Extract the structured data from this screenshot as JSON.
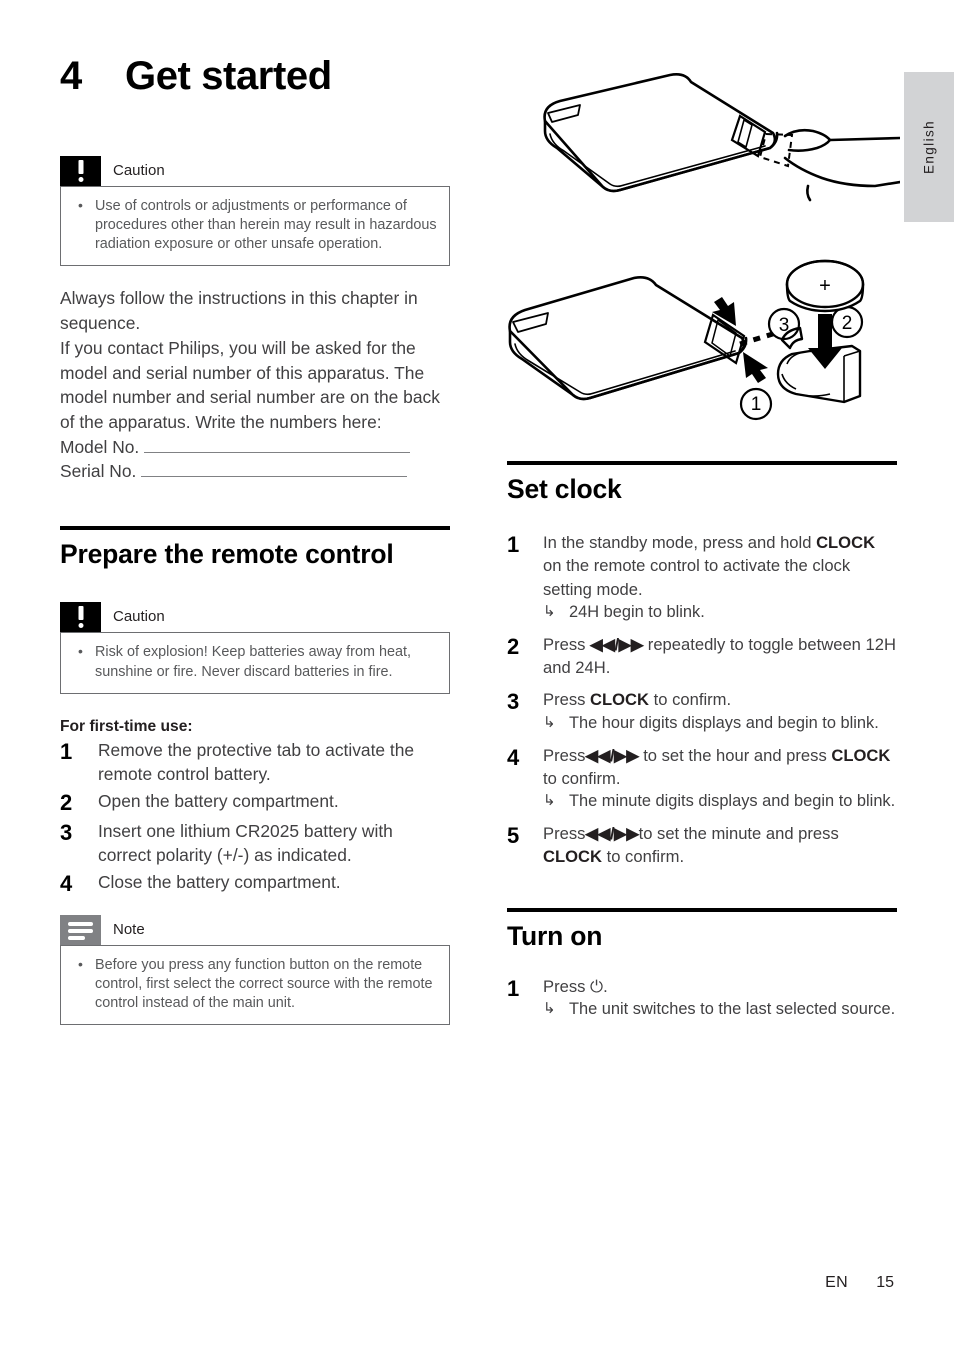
{
  "language_tab": {
    "label": "English"
  },
  "chapter": {
    "number": "4",
    "title": "Get started"
  },
  "caution_radiation": {
    "icon": "caution-exclamation-icon",
    "title": "Caution",
    "items": [
      "Use of controls or adjustments or performance of procedures other than herein may result in hazardous radiation exposure or other unsafe operation."
    ]
  },
  "intro": {
    "paragraph1": "Always follow the instructions in this chapter in sequence.",
    "paragraph2": "If you contact Philips, you will be asked for the model and serial number of this apparatus. The model number and serial number are on the back of the apparatus. Write the numbers here:",
    "model_label": "Model No.",
    "serial_label": "Serial No."
  },
  "prepare_remote": {
    "heading": "Prepare the remote control",
    "caution": {
      "icon": "caution-exclamation-icon",
      "title": "Caution",
      "items": [
        "Risk of explosion! Keep batteries away from heat, sunshine or fire. Never discard batteries in fire."
      ]
    },
    "subheading": "For first-time use:",
    "steps": [
      {
        "number": "1",
        "text": "Remove the protective tab to activate the remote control battery."
      },
      {
        "number": "2",
        "text": "Open the battery compartment."
      },
      {
        "number": "3",
        "text": "Insert one lithium CR2025 battery with correct polarity (+/-) as indicated."
      },
      {
        "number": "4",
        "text": "Close the battery compartment."
      }
    ],
    "note": {
      "icon": "note-lines-icon",
      "title": "Note",
      "items": [
        "Before you press any function button on the remote control, first select the correct source with the remote control instead of the main unit."
      ]
    }
  },
  "illustrations": {
    "remote_tab": {
      "name": "remote-control-pull-tab-illustration",
      "description": "Remote control with a hand pulling the protective battery tab"
    },
    "remote_battery": {
      "name": "remote-control-battery-illustration",
      "description": "Remote control battery compartment with coin cell battery",
      "battery_polarity": "+",
      "callouts": [
        "1",
        "2",
        "3"
      ]
    }
  },
  "set_clock": {
    "heading": "Set clock",
    "steps": [
      {
        "number": "1",
        "pre": "In the standby mode, press and hold ",
        "bold": "CLOCK",
        "post": " on the remote control to activate the clock setting mode.",
        "substeps": [
          "24H begin to blink."
        ]
      },
      {
        "number": "2",
        "pre": "Press ",
        "glyph": "◀◀/▶▶",
        "post": " repeatedly to toggle between 12H and 24H.",
        "substeps": []
      },
      {
        "number": "3",
        "pre": "Press ",
        "bold": "CLOCK",
        "post": " to confirm.",
        "substeps": [
          "The hour digits displays and begin to blink."
        ]
      },
      {
        "number": "4",
        "pre": "Press",
        "glyph": "◀◀/▶▶",
        "mid": " to set the hour and press ",
        "bold": "CLOCK",
        "post": " to confirm.",
        "substeps": [
          "The minute digits displays and begin to blink."
        ]
      },
      {
        "number": "5",
        "pre": "Press",
        "glyph": "◀◀/▶▶",
        "mid": "to set the minute and press ",
        "bold": "CLOCK",
        "post": " to confirm.",
        "substeps": []
      }
    ]
  },
  "turn_on": {
    "heading": "Turn on",
    "steps": [
      {
        "number": "1",
        "pre": "Press ",
        "glyph": "⏻",
        "post": ".",
        "substeps": [
          "The unit switches to the last selected source."
        ]
      }
    ]
  },
  "footer": {
    "lang_code": "EN",
    "page_number": "15"
  },
  "colors": {
    "caution_icon_bg": "#000000",
    "note_icon_bg": "#808184",
    "body_text": "#414042",
    "callout_text": "#58595b",
    "rule": "#000000",
    "lang_tab_bg": "#d2d3d5"
  }
}
